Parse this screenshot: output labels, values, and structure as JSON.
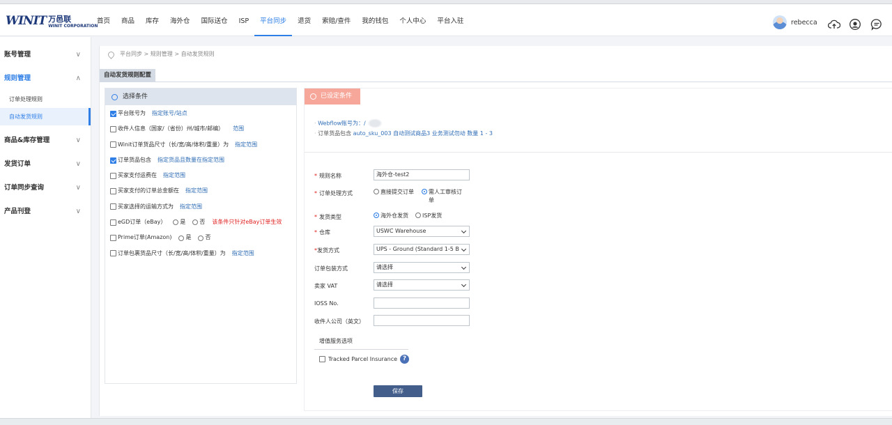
{
  "header": {
    "logo_mark": "WINIT",
    "logo_cn": "万邑联",
    "logo_en": "WINIT CORPORATION",
    "nav": [
      "首页",
      "商品",
      "库存",
      "海外仓",
      "国际送仓",
      "ISP",
      "平台同步",
      "退货",
      "索赔/查件",
      "我的钱包",
      "个人中心",
      "平台入驻"
    ],
    "active_nav": "平台同步",
    "username": "rebecca",
    "icons": [
      "cloud-upload-icon",
      "support-icon",
      "chat-icon"
    ]
  },
  "sidebar": {
    "groups": [
      {
        "label": "账号管理",
        "chevron": "∨"
      },
      {
        "label": "规则管理",
        "chevron": "∧",
        "subs": [
          "订单处理规则",
          "自动发货规则"
        ]
      },
      {
        "label": "商品&库存管理",
        "chevron": "∨"
      },
      {
        "label": "发货订单",
        "chevron": "∨"
      },
      {
        "label": "订单同步查询",
        "chevron": "∨"
      },
      {
        "label": "产品刊登",
        "chevron": "∨"
      }
    ]
  },
  "breadcrumb": "平台同步 > 规则管理 > 自动发货规则",
  "tab_title": "自动发货规则配置",
  "conditions": {
    "header": "选择条件",
    "rows": [
      {
        "label": "平台账号为",
        "checked": true,
        "link": "指定账号/站点"
      },
      {
        "label": "收件人信息（国家/（省份）州/城市/邮编）",
        "checked": false,
        "link": "范围"
      },
      {
        "label": "Winit订单货品尺寸（长/宽/高/体积/重量）为",
        "checked": false,
        "link": "指定范围"
      },
      {
        "label": "订单货品包含",
        "checked": true,
        "link": "指定货品且数量在指定范围"
      },
      {
        "label": "买家支付运费在",
        "checked": false,
        "link": "指定范围"
      },
      {
        "label": "买家支付的订单总金额在",
        "checked": false,
        "link": "指定范围"
      },
      {
        "label": "买家选择的运输方式为",
        "checked": false,
        "link": "指定范围"
      },
      {
        "label": "eGD订单（eBay）",
        "checked": false,
        "yes": "是",
        "no": "否",
        "note": "该条件只针对eBay订单生效"
      },
      {
        "label": "Prime订单(Amazon)",
        "checked": false,
        "yes": "是",
        "no": "否"
      },
      {
        "label": "订单包裹货品尺寸（长/宽/高/体积/重量）为",
        "checked": false,
        "link": "指定范围"
      }
    ]
  },
  "configured": {
    "badge": "已设定条件",
    "summary1": "Webflow账号为：",
    "summary1_tail": "/",
    "summary2_prefix": "订单货品包含",
    "summary2_items": "auto_sku_003 自动测试商品3 业务测试勿动",
    "summary2_qty": "数量 1 - 3"
  },
  "form": {
    "rule_name_label": "规则名称",
    "rule_name_value": "海外仓-test2",
    "process_label": "订单处理方式",
    "process_opt1": "直接提交订单",
    "process_opt2_l1": "需人工审核订",
    "process_opt2_l2": "单",
    "process_selected": "需人工审核订单",
    "ship_type_label": "发货类型",
    "ship_type_opt1": "海外仓发货",
    "ship_type_opt2": "ISP发货",
    "ship_type_selected": "海外仓发货",
    "warehouse_label": "仓库",
    "warehouse_value": "USWC Warehouse",
    "ship_method_label": "发货方式",
    "ship_method_value": "UPS - Ground (Standard 1-5 B",
    "pack_label": "订单包装方式",
    "pack_value": "请选择",
    "vat_label": "卖家 VAT",
    "vat_value": "请选择",
    "ioss_label": "IOSS No.",
    "ioss_value": "",
    "company_label": "收件人公司（英文）",
    "company_value": "",
    "vas_label": "增值服务选项",
    "insurance_label": "Tracked Parcel Insurance",
    "insurance_checked": false,
    "save": "保存"
  },
  "colors": {
    "accent": "#2f7fe6",
    "badge": "#f6a79a",
    "save_button": "#435e8b",
    "required": "#e02020"
  }
}
